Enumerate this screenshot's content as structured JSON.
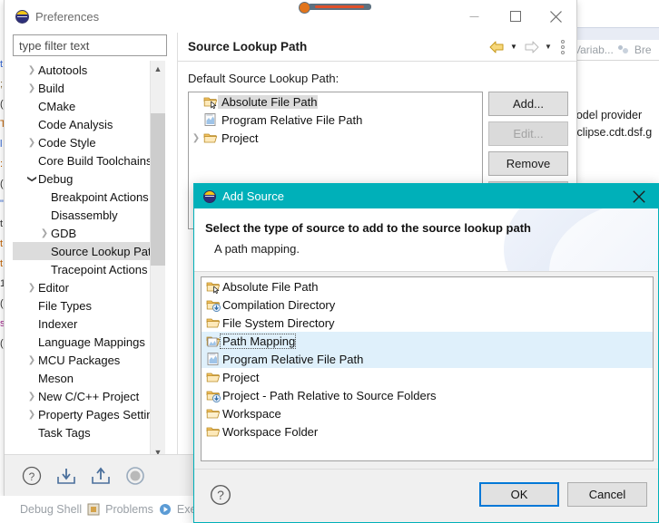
{
  "background": {
    "tabs": [
      {
        "icon": "variables-icon",
        "label": "Variab..."
      },
      {
        "icon": "breakpoints-icon",
        "label": "Bre"
      }
    ],
    "code_lines": [
      "o model provider",
      "rg.eclipse.cdt.dsf.g"
    ],
    "status_bar": {
      "items": [
        {
          "icon": "debug-shell-icon",
          "label": "Debug Shell"
        },
        {
          "icon": "problems-icon",
          "label": "Problems"
        },
        {
          "icon": "executables-icon",
          "label": "Exec"
        }
      ]
    }
  },
  "preferences": {
    "title": "Preferences",
    "title_icon": "eclipse-globe-icon",
    "window_controls": {
      "minimize": "minimize-icon",
      "maximize": "maximize-icon",
      "close": "close-icon"
    },
    "filter": {
      "value": "",
      "placeholder": "type filter text"
    },
    "tree": [
      {
        "label": "Autotools",
        "level": 1,
        "arrow": "collapsed",
        "selected": false
      },
      {
        "label": "Build",
        "level": 1,
        "arrow": "collapsed",
        "selected": false
      },
      {
        "label": "CMake",
        "level": 1,
        "arrow": "none",
        "selected": false
      },
      {
        "label": "Code Analysis",
        "level": 1,
        "arrow": "none",
        "selected": false
      },
      {
        "label": "Code Style",
        "level": 1,
        "arrow": "collapsed",
        "selected": false
      },
      {
        "label": "Core Build Toolchains",
        "level": 1,
        "arrow": "none",
        "selected": false
      },
      {
        "label": "Debug",
        "level": 1,
        "arrow": "expanded",
        "selected": false
      },
      {
        "label": "Breakpoint Actions",
        "level": 2,
        "arrow": "none",
        "selected": false
      },
      {
        "label": "Disassembly",
        "level": 2,
        "arrow": "none",
        "selected": false
      },
      {
        "label": "GDB",
        "level": 2,
        "arrow": "collapsed",
        "selected": false
      },
      {
        "label": "Source Lookup Path",
        "level": 2,
        "arrow": "none",
        "selected": true
      },
      {
        "label": "Tracepoint Actions",
        "level": 2,
        "arrow": "none",
        "selected": false
      },
      {
        "label": "Editor",
        "level": 1,
        "arrow": "collapsed",
        "selected": false
      },
      {
        "label": "File Types",
        "level": 1,
        "arrow": "none",
        "selected": false
      },
      {
        "label": "Indexer",
        "level": 1,
        "arrow": "none",
        "selected": false
      },
      {
        "label": "Language Mappings",
        "level": 1,
        "arrow": "none",
        "selected": false
      },
      {
        "label": "MCU Packages",
        "level": 1,
        "arrow": "collapsed",
        "selected": false
      },
      {
        "label": "Meson",
        "level": 1,
        "arrow": "none",
        "selected": false
      },
      {
        "label": "New C/C++ Project",
        "level": 1,
        "arrow": "collapsed",
        "selected": false
      },
      {
        "label": "Property Pages Settings",
        "level": 1,
        "arrow": "collapsed",
        "selected": false
      },
      {
        "label": "Task Tags",
        "level": 1,
        "arrow": "none",
        "selected": false
      }
    ],
    "page": {
      "title": "Source Lookup Path",
      "nav": {
        "back_icon": "back-arrow-icon",
        "back_menu_icon": "chevron-down-icon",
        "forward_icon": "forward-arrow-icon",
        "forward_menu_icon": "chevron-down-icon",
        "menu_icon": "vertical-dots-icon"
      },
      "section_label": "Default Source Lookup Path:",
      "lookup_entries": [
        {
          "label": "Absolute File Path",
          "icon": "absolute-file-path-icon",
          "expandable": false,
          "selected": true
        },
        {
          "label": "Program Relative File Path",
          "icon": "program-relative-file-path-icon",
          "expandable": false,
          "selected": false
        },
        {
          "label": "Project",
          "icon": "project-folder-icon",
          "expandable": true,
          "selected": false
        }
      ],
      "buttons": [
        {
          "label": "Add...",
          "enabled": true
        },
        {
          "label": "Edit...",
          "enabled": false
        },
        {
          "label": "Remove",
          "enabled": true
        }
      ]
    },
    "bottom_icons": [
      "help-icon",
      "import-icon",
      "export-icon",
      "restore-defaults-icon"
    ]
  },
  "add_source_dialog": {
    "title": "Add Source",
    "title_icon": "eclipse-globe-icon",
    "close_icon": "close-icon",
    "heading": "Select the type of source to add to the source lookup path",
    "description": "A path mapping.",
    "accent_color": "#00b0b9",
    "selection_color": "#dff0fb",
    "items": [
      {
        "label": "Absolute File Path",
        "icon": "absolute-file-path-icon",
        "highlighted": false,
        "focused": false
      },
      {
        "label": "Compilation Directory",
        "icon": "compilation-directory-icon",
        "highlighted": false,
        "focused": false
      },
      {
        "label": "File System Directory",
        "icon": "file-system-directory-icon",
        "highlighted": false,
        "focused": false
      },
      {
        "label": "Path Mapping",
        "icon": "path-mapping-icon",
        "highlighted": true,
        "focused": true
      },
      {
        "label": "Program Relative File Path",
        "icon": "program-relative-file-path-icon",
        "highlighted": true,
        "focused": false
      },
      {
        "label": "Project",
        "icon": "project-folder-icon",
        "highlighted": false,
        "focused": false
      },
      {
        "label": "Project - Path Relative to Source Folders",
        "icon": "project-path-relative-icon",
        "highlighted": false,
        "focused": false
      },
      {
        "label": "Workspace",
        "icon": "workspace-icon",
        "highlighted": false,
        "focused": false
      },
      {
        "label": "Workspace Folder",
        "icon": "workspace-folder-icon",
        "highlighted": false,
        "focused": false
      }
    ],
    "help_icon": "help-icon",
    "ok_label": "OK",
    "cancel_label": "Cancel"
  }
}
